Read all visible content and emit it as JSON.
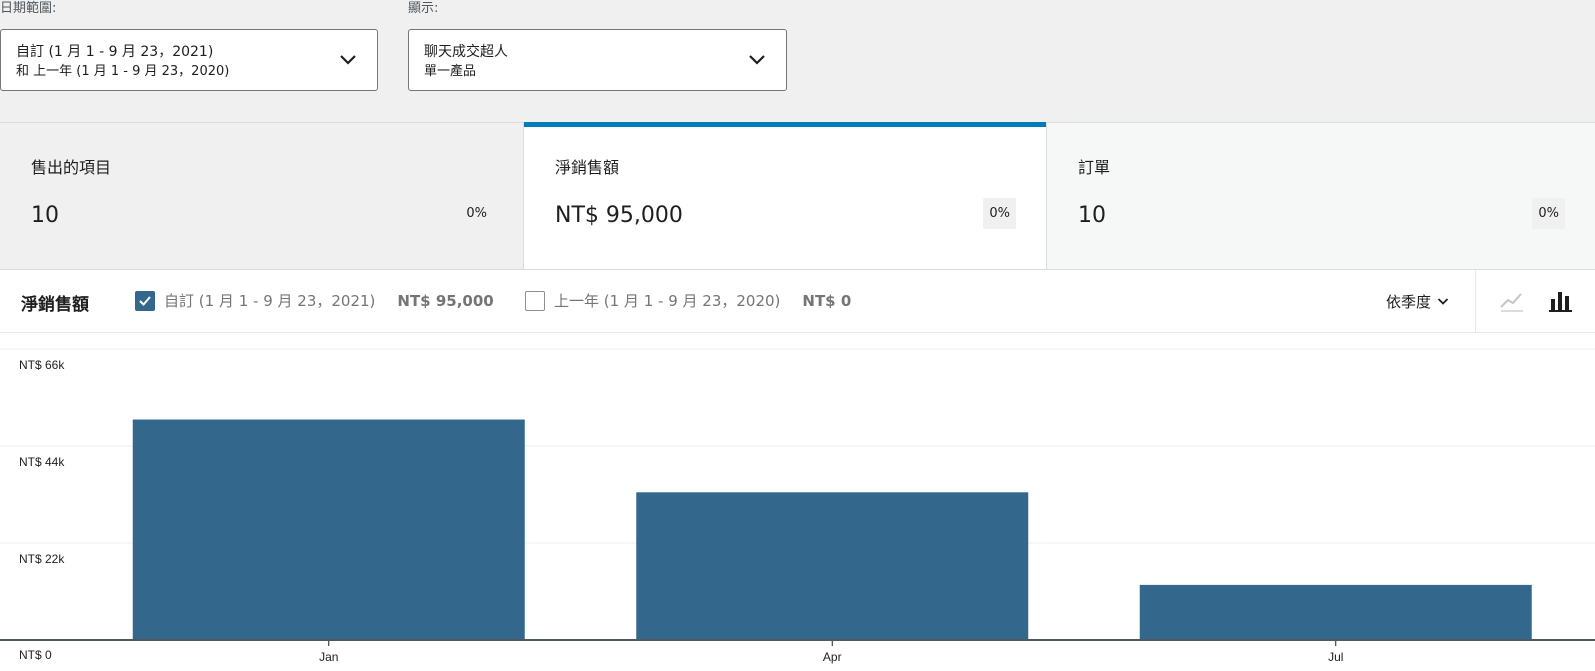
{
  "filters": {
    "date_range": {
      "label": "日期範圍:",
      "primary": "自訂 (1 月 1 - 9 月 23，2021)",
      "secondary": "和 上一年 (1 月 1 - 9 月 23，2020)"
    },
    "show": {
      "label": "顯示:",
      "primary": "聊天成交超人",
      "secondary": "單一產品"
    }
  },
  "summary": [
    {
      "label": "售出的項目",
      "value": "10",
      "delta": "0%"
    },
    {
      "label": "淨銷售額",
      "value": "NT$ 95,000",
      "delta": "0%"
    },
    {
      "label": "訂單",
      "value": "10",
      "delta": "0%"
    }
  ],
  "chart_header": {
    "title": "淨銷售額",
    "current": {
      "label": "自訂 (1 月 1 - 9 月 23，2021)",
      "value": "NT$ 95,000",
      "checked": true
    },
    "previous": {
      "label": "上一年 (1 月 1 - 9 月 23，2020)",
      "value": "NT$ 0",
      "checked": false
    },
    "interval": "依季度"
  },
  "colors": {
    "accent": "#007cba",
    "bar": "#33688c",
    "checkbox": "#33688c"
  },
  "chart_data": {
    "type": "bar",
    "categories": [
      "Jan",
      "Apr",
      "Jul"
    ],
    "values": [
      50000,
      33500,
      12500
    ],
    "y_ticks": [
      "NT$ 0",
      "NT$ 22k",
      "NT$ 44k",
      "NT$ 66k"
    ],
    "ylim": [
      0,
      66000
    ],
    "grid": true
  }
}
